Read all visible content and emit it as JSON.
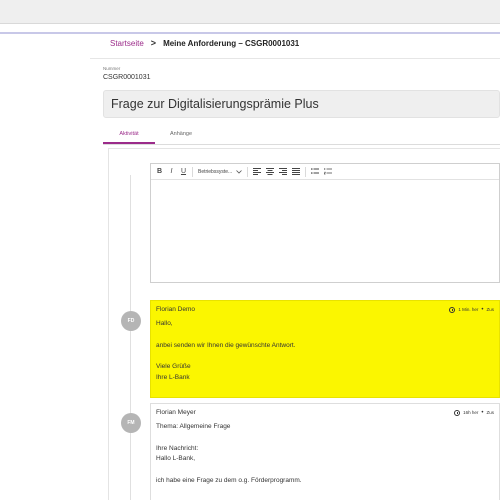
{
  "breadcrumb": {
    "home": "Startseite",
    "separator": ">",
    "current": "Meine Anforderung – CSGR0001031"
  },
  "record": {
    "number_label": "Nummer",
    "number": "CSGR0001031",
    "title": "Frage zur Digitalisierungsprämie Plus"
  },
  "tabs": [
    {
      "label": "Aktivität",
      "active": true
    },
    {
      "label": "Anhänge",
      "active": false
    }
  ],
  "editor": {
    "bold": "B",
    "italic": "I",
    "underline": "U",
    "format_select": "Betriebssyste...",
    "value": ""
  },
  "entries": [
    {
      "initials": "FD",
      "author": "Florian Demo",
      "time": "1 Min. her",
      "extra": "Zus",
      "highlight": true,
      "lines": [
        "Hallo,",
        "",
        "anbei senden wir Ihnen die gewünschte Antwort.",
        "",
        "Viele Grüße",
        "Ihre L-Bank"
      ]
    },
    {
      "initials": "FM",
      "author": "Florian Meyer",
      "time": "16h her",
      "extra": "Zus",
      "highlight": false,
      "lines": [
        "Thema: Allgemeine Frage",
        "",
        "Ihre Nachricht:",
        "Hallo L-Bank,",
        "",
        "ich habe eine Frage zu dem o.g. Förderprogramm."
      ]
    }
  ],
  "colors": {
    "accent": "#9b2b8a",
    "highlight": "#fbf600"
  }
}
